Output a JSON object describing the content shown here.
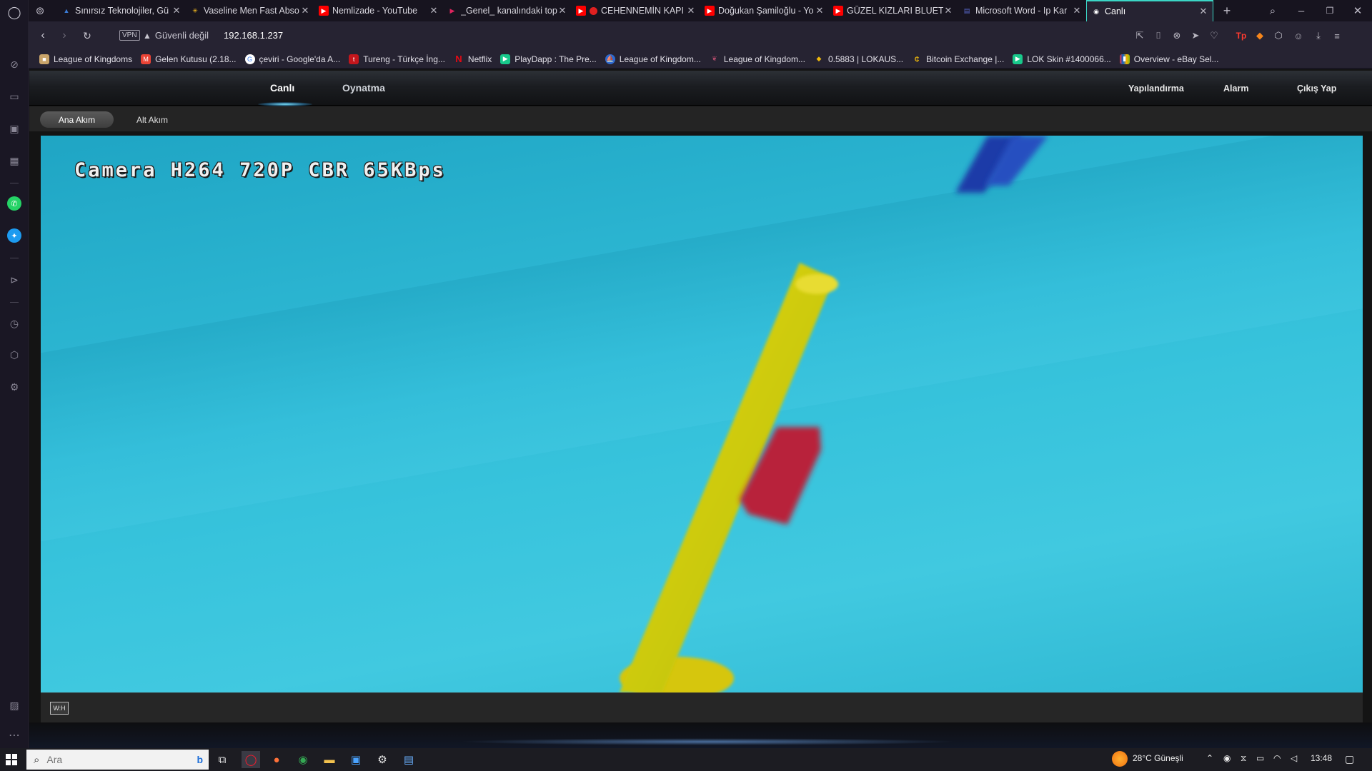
{
  "browser": {
    "tabs": [
      {
        "title": "Sınırsız Teknolojiler, Gü",
        "icon": "triangle-icon",
        "color": "#3a7bd5"
      },
      {
        "title": "Vaseline Men Fast Abso",
        "icon": "walmart-icon",
        "color": "#ffc220"
      },
      {
        "title": "Nemlizade - YouTube",
        "icon": "youtube-icon",
        "color": "#ff0000"
      },
      {
        "title": "_Genel_ kanalındaki top",
        "icon": "play-icon",
        "color": "#e0245e"
      },
      {
        "title": "CEHENNEMİN KAPI",
        "icon": "youtube-icon",
        "color": "#ff0000"
      },
      {
        "title": "Doğukan Şamiloğlu - Yo",
        "icon": "youtube-icon",
        "color": "#ff0000"
      },
      {
        "title": "GÜZEL KIZLARI BLUETO",
        "icon": "youtube-icon",
        "color": "#ff0000"
      },
      {
        "title": "Microsoft Word - Ip Kar",
        "icon": "document-icon",
        "color": "#5a6ad0"
      },
      {
        "title": "Canlı",
        "icon": "globe-icon",
        "color": "#ffffff",
        "active": true
      }
    ],
    "vpn_label": "VPN",
    "security_text": "Güvenli değil",
    "url": "192.168.1.237",
    "bookmarks": [
      {
        "label": "League of Kingdoms",
        "color": "#c9a46a"
      },
      {
        "label": "Gelen Kutusu (2.18...",
        "color": "#ea4335"
      },
      {
        "label": "çeviri - Google'da A...",
        "color": "#4285f4"
      },
      {
        "label": "Tureng - Türkçe İng...",
        "color": "#c4161c"
      },
      {
        "label": "Netflix",
        "color": "#e50914"
      },
      {
        "label": "PlayDapp : The Pre...",
        "color": "#18c98b"
      },
      {
        "label": "League of Kingdom...",
        "color": "#2f6ad0"
      },
      {
        "label": "League of Kingdom...",
        "color": "#b04a6a"
      },
      {
        "label": "0.5883 | LOKAUS...",
        "color": "#f0b90b"
      },
      {
        "label": "Bitcoin Exchange |...",
        "color": "#f0b90b"
      },
      {
        "label": "LOK Skin #1400066...",
        "color": "#18c98b"
      },
      {
        "label": "Overview - eBay Sel...",
        "color": "#e53238"
      }
    ]
  },
  "camera_ui": {
    "nav": {
      "live": "Canlı",
      "playback": "Oynatma",
      "config": "Yapılandırma",
      "alarm": "Alarm",
      "logout": "Çıkış Yap"
    },
    "stream": {
      "main": "Ana Akım",
      "sub": "Alt Akım"
    },
    "osd_text": "Camera H264 720P CBR 65KBps",
    "ratio_button": "W:H"
  },
  "taskbar": {
    "search_placeholder": "Ara",
    "weather": "28°C  Güneşli",
    "time": "13:48"
  }
}
